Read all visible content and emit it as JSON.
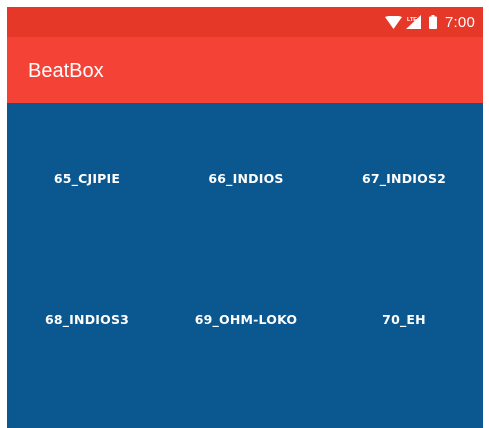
{
  "status_bar": {
    "time": "7:00",
    "network": "LTE",
    "icons": [
      "wifi-icon",
      "signal-icon",
      "battery-icon"
    ],
    "color": "#e53828"
  },
  "app_bar": {
    "title": "BeatBox",
    "color": "#f44336"
  },
  "grid": {
    "background": "#0b5891",
    "buttons": [
      {
        "label": "65_CJIPIE"
      },
      {
        "label": "66_INDIOS"
      },
      {
        "label": "67_INDIOS2"
      },
      {
        "label": "68_INDIOS3"
      },
      {
        "label": "69_OHM-LOKO"
      },
      {
        "label": "70_EH"
      }
    ]
  }
}
